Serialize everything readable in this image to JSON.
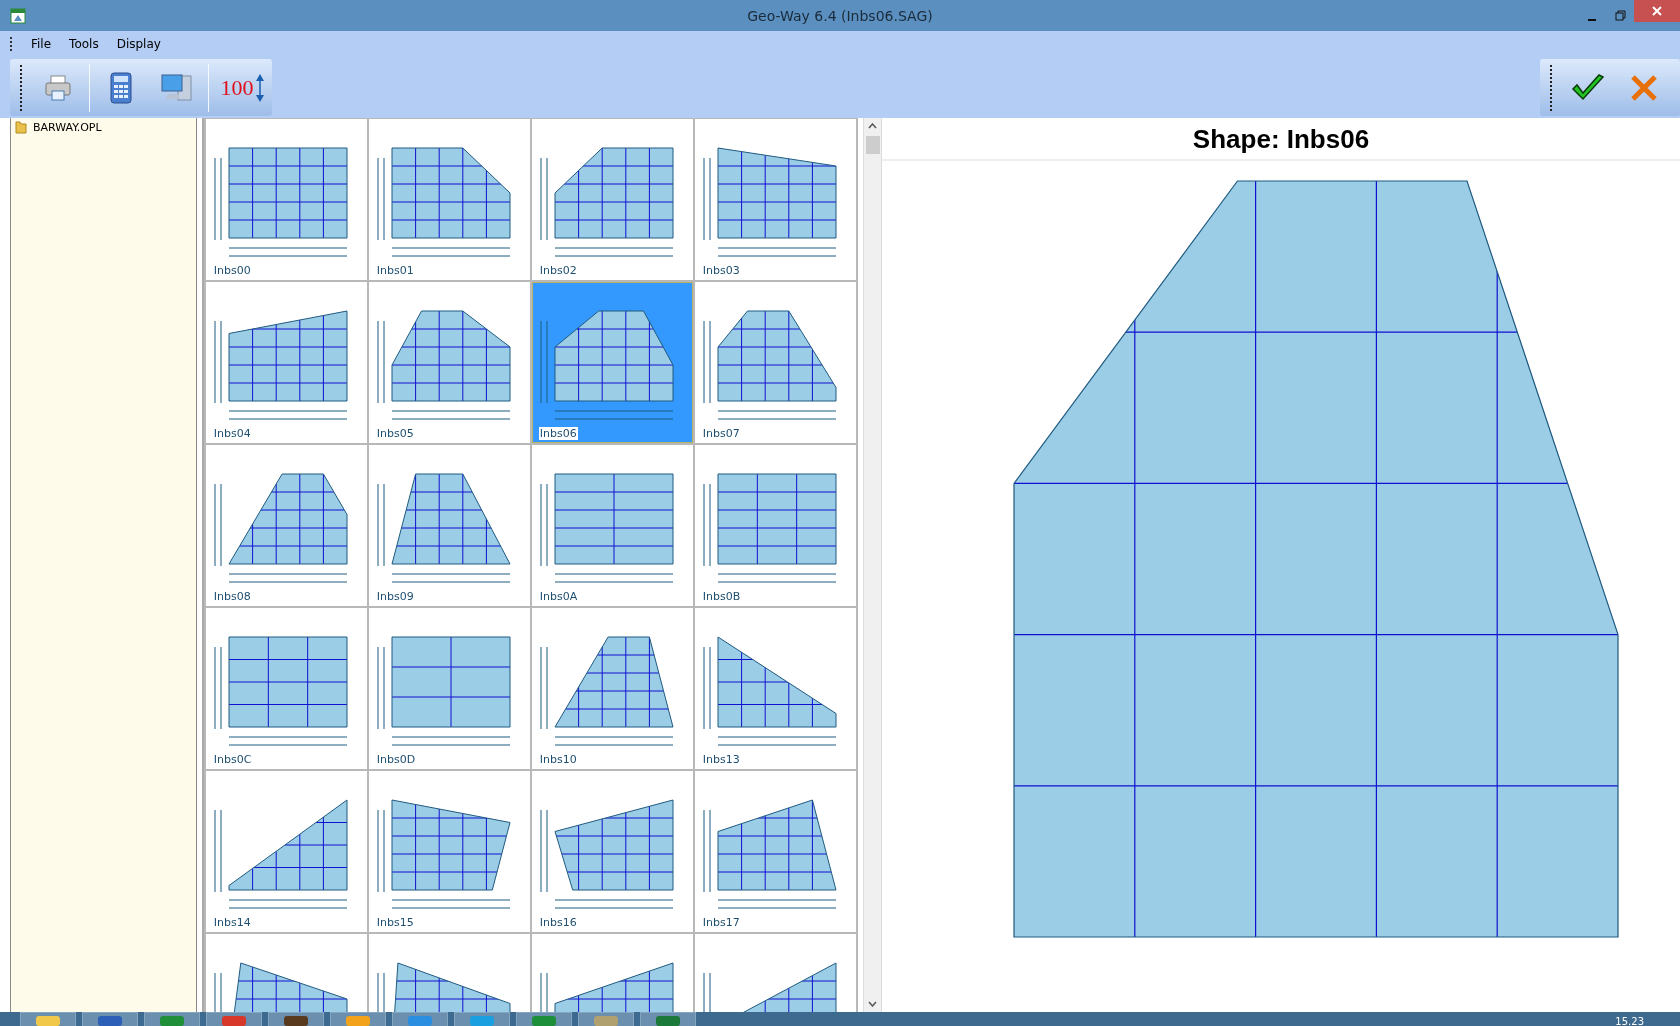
{
  "window": {
    "title": "Geo-Way 6.4 (Inbs06.SAG)"
  },
  "menu": [
    "File",
    "Tools",
    "Display"
  ],
  "toolbar": {
    "zoom_label": "100"
  },
  "tree": [
    {
      "label": "BARWAY.OPL"
    }
  ],
  "shapes": [
    {
      "label": "Inbs00",
      "selected": false
    },
    {
      "label": "Inbs01",
      "selected": false
    },
    {
      "label": "Inbs02",
      "selected": false
    },
    {
      "label": "Inbs03",
      "selected": false
    },
    {
      "label": "Inbs04",
      "selected": false
    },
    {
      "label": "Inbs05",
      "selected": false
    },
    {
      "label": "Inbs06",
      "selected": true
    },
    {
      "label": "Inbs07",
      "selected": false
    },
    {
      "label": "Inbs08",
      "selected": false
    },
    {
      "label": "Inbs09",
      "selected": false
    },
    {
      "label": "Inbs0A",
      "selected": false
    },
    {
      "label": "Inbs0B",
      "selected": false
    },
    {
      "label": "Inbs0C",
      "selected": false
    },
    {
      "label": "Inbs0D",
      "selected": false
    },
    {
      "label": "Inbs10",
      "selected": false
    },
    {
      "label": "Inbs13",
      "selected": false
    },
    {
      "label": "Inbs14",
      "selected": false
    },
    {
      "label": "Inbs15",
      "selected": false
    },
    {
      "label": "Inbs16",
      "selected": false
    },
    {
      "label": "Inbs17",
      "selected": false
    },
    {
      "selected": false
    },
    {
      "selected": false
    },
    {
      "selected": false
    },
    {
      "selected": false
    }
  ],
  "preview": {
    "title": "Shape: Inbs06"
  },
  "taskbar": {
    "clock": "15.23"
  }
}
